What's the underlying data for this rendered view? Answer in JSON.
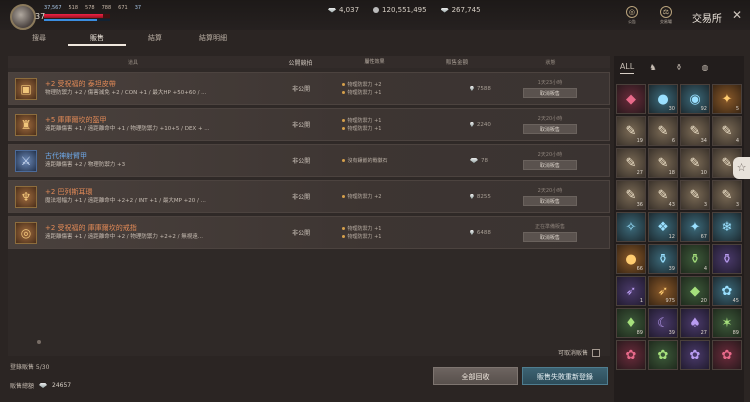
{
  "player": {
    "level": "37",
    "stat1": "37,567",
    "stat2": "518",
    "stat3": "578",
    "stat4": "788",
    "stat5": "671",
    "stat6": "37",
    "hp_fraction": 0.9,
    "mp_fraction": 0.8
  },
  "currency": {
    "diamonds": "4,037",
    "gold": "120,551,495",
    "red_diamonds": "267,745"
  },
  "topright": {
    "btn1": "公告",
    "btn2": "交易場",
    "title": "交易所",
    "close": "✕"
  },
  "tabs": [
    "搜尋",
    "販售",
    "結算",
    "結算明細"
  ],
  "active_tab": "販售",
  "table": {
    "headers": [
      "道具",
      "公開競拍",
      "屬性效果",
      "販售金額",
      "狀態"
    ],
    "rows": [
      {
        "icon": "belt-icon",
        "glyph": "▣",
        "name": "+2 受祝福的 泰坦皮帶",
        "name_color": "orange",
        "desc": "物理防禦力 +2 / 傷害減免 +2 / CON +1 / 最大HP +50+60 / ...",
        "public": "非公開",
        "attrs": [
          "物理防禦力 +2",
          "物理防禦力 +1"
        ],
        "price": "7588",
        "status_time": "1天23小時",
        "cancel": "取消販售"
      },
      {
        "icon": "armor-icon",
        "glyph": "♜",
        "name": "+5 庫庫爾坎的盔甲",
        "name_color": "orange",
        "desc": "遠距離傷害 +1 / 遠距離命中 +1 / 物理防禦力 +10+5 / DEX + ...",
        "public": "非公開",
        "attrs": [
          "物理防禦力 +1",
          "物理防禦力 +1"
        ],
        "price": "2240",
        "status_time": "2天20小時",
        "cancel": "取消販售"
      },
      {
        "icon": "bracer-icon",
        "glyph": "⚔",
        "name": "古代神射臂甲",
        "name_color": "blue",
        "desc": "遠距離傷害 +2 / 物理防禦力 +3",
        "public": "非公開",
        "attrs": [
          "沒有鑲嵌的戰徽石"
        ],
        "price": "78",
        "status_time": "2天20小時",
        "cancel": "取消販售"
      },
      {
        "icon": "earring-icon",
        "glyph": "♆",
        "name": "+2 巴列斯耳環",
        "name_color": "orange",
        "desc": "魔法增幅力 +1 / 遠距離命中 +2+2 / INT +1 / 最大MP +20 / ...",
        "public": "非公開",
        "attrs": [
          "物理防禦力 +2"
        ],
        "price": "8255",
        "status_time": "2天20小時",
        "cancel": "取消販售"
      },
      {
        "icon": "ring-icon",
        "glyph": "◎",
        "name": "+2 受祝福的 庫庫爾坎的戒指",
        "name_color": "orange",
        "desc": "遠距離傷害 +1 / 遠距離命中 +2 / 物理防禦力 +2+2 / 無視遠...",
        "public": "非公開",
        "attrs": [
          "物理防禦力 +1",
          "物理防禦力 +1"
        ],
        "price": "6488",
        "status_time": "正在準備販售",
        "cancel": "取消販售"
      }
    ]
  },
  "footer": {
    "cancelable": "可取消販售",
    "registered": "登錄販售 5/30",
    "total_label": "販售總額",
    "total_value": "24657",
    "btn_all": "全部回收",
    "btn_relist": "販售失敗重新登錄"
  },
  "inventory": {
    "tabs": [
      {
        "name": "all-tab",
        "glyph": "ALL"
      },
      {
        "name": "helmet-tab",
        "glyph": "♞"
      },
      {
        "name": "potion-tab",
        "glyph": "⚱"
      },
      {
        "name": "misc-tab",
        "glyph": "◍"
      }
    ],
    "slots": [
      {
        "k": "gem-r",
        "g": "◆",
        "n": ""
      },
      {
        "k": "gem-b",
        "g": "●",
        "n": "30"
      },
      {
        "k": "gem-b",
        "g": "◉",
        "n": "92"
      },
      {
        "k": "orange",
        "g": "✦",
        "n": "5"
      },
      {
        "k": "scroll",
        "g": "✎",
        "n": "19"
      },
      {
        "k": "scroll",
        "g": "✎",
        "n": "6"
      },
      {
        "k": "scroll",
        "g": "✎",
        "n": "34"
      },
      {
        "k": "scroll",
        "g": "✎",
        "n": "4"
      },
      {
        "k": "scroll",
        "g": "✎",
        "n": "27"
      },
      {
        "k": "scroll",
        "g": "✎",
        "n": "18"
      },
      {
        "k": "scroll",
        "g": "✎",
        "n": "10"
      },
      {
        "k": "scroll",
        "g": "✎",
        "n": "7"
      },
      {
        "k": "scroll",
        "g": "✎",
        "n": "36"
      },
      {
        "k": "scroll",
        "g": "✎",
        "n": "43"
      },
      {
        "k": "scroll",
        "g": "✎",
        "n": "3"
      },
      {
        "k": "scroll",
        "g": "✎",
        "n": "3"
      },
      {
        "k": "gem-b",
        "g": "✧",
        "n": ""
      },
      {
        "k": "gem-b",
        "g": "❖",
        "n": "12"
      },
      {
        "k": "gem-b",
        "g": "✦",
        "n": "67"
      },
      {
        "k": "gem-b",
        "g": "❄",
        "n": ""
      },
      {
        "k": "orange",
        "g": "●",
        "n": "66"
      },
      {
        "k": "gem-b",
        "g": "⚱",
        "n": "39"
      },
      {
        "k": "gem-g",
        "g": "⚱",
        "n": "4"
      },
      {
        "k": "gem-p",
        "g": "⚱",
        "n": ""
      },
      {
        "k": "gem-p",
        "g": "➶",
        "n": "1"
      },
      {
        "k": "orange",
        "g": "➶",
        "n": "975"
      },
      {
        "k": "gem-g",
        "g": "◆",
        "n": "20"
      },
      {
        "k": "gem-b",
        "g": "✿",
        "n": "45"
      },
      {
        "k": "gem-g",
        "g": "♦",
        "n": "89"
      },
      {
        "k": "gem-p",
        "g": "☾",
        "n": "39"
      },
      {
        "k": "gem-p",
        "g": "♠",
        "n": "27"
      },
      {
        "k": "gem-g",
        "g": "✶",
        "n": "89"
      },
      {
        "k": "gem-r",
        "g": "✿",
        "n": ""
      },
      {
        "k": "gem-g",
        "g": "✿",
        "n": ""
      },
      {
        "k": "gem-p",
        "g": "✿",
        "n": ""
      },
      {
        "k": "gem-r",
        "g": "✿",
        "n": ""
      }
    ]
  },
  "side_button": "☆"
}
